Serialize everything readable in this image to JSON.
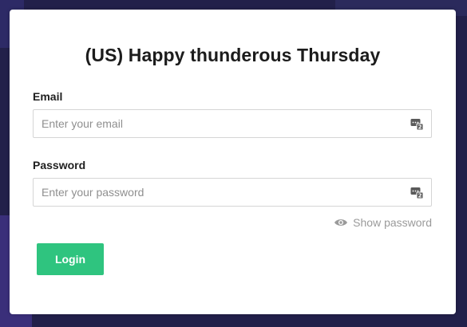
{
  "page": {
    "title": "(US) Happy thunderous Thursday"
  },
  "form": {
    "email": {
      "label": "Email",
      "placeholder": "Enter your email",
      "value": "",
      "autofill_icon": "password-manager-icon"
    },
    "password": {
      "label": "Password",
      "placeholder": "Enter your password",
      "value": "",
      "autofill_icon": "password-manager-icon"
    },
    "show_password": {
      "label": "Show password",
      "icon": "eye-icon"
    },
    "login_label": "Login"
  },
  "colors": {
    "background": "#22204a",
    "card": "#ffffff",
    "accent": "#2fc47f",
    "muted_text": "#9a9a9a"
  }
}
